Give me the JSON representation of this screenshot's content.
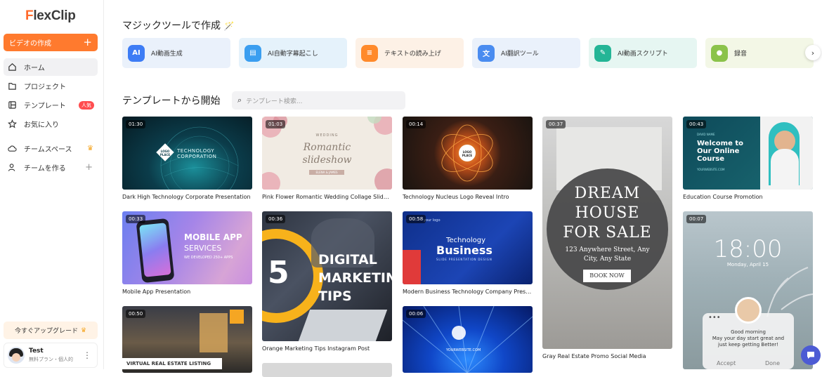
{
  "app": {
    "logo_prefix": "F",
    "logo_rest": "lexClip"
  },
  "sidebar": {
    "create_label": "ビデオの作成",
    "create_plus": "+",
    "items": [
      {
        "label": "ホーム",
        "icon": "home-icon"
      },
      {
        "label": "プロジェクト",
        "icon": "folder-icon"
      },
      {
        "label": "テンプレート",
        "icon": "template-icon",
        "badge": "人気"
      },
      {
        "label": "お気に入り",
        "icon": "star-icon"
      },
      {
        "label": "チームスペース",
        "icon": "cloud-icon"
      },
      {
        "label": "チームを作る",
        "icon": "user-add-icon"
      }
    ],
    "upgrade_label": "今すぐアップグレード",
    "user": {
      "name": "Test",
      "plan": "無料プラン・個人的"
    }
  },
  "magic": {
    "title": "マジックツールで作成",
    "tools": [
      {
        "label": "AI動画生成",
        "bg": "#eaf1fb",
        "icon_bg": "#3d7cf5",
        "glyph": "AI"
      },
      {
        "label": "AI自動字幕起こし",
        "bg": "#e5f2fb",
        "icon_bg": "#3a9ef0",
        "glyph": "▤"
      },
      {
        "label": "テキストの読み上げ",
        "bg": "#fdf1e6",
        "icon_bg": "#ff8a2b",
        "glyph": "≡"
      },
      {
        "label": "AI翻訳ツール",
        "bg": "#eaf1fb",
        "icon_bg": "#4a8cf0",
        "glyph": "文"
      },
      {
        "label": "AI動画スクリプト",
        "bg": "#e6f6f2",
        "icon_bg": "#24b596",
        "glyph": "✎"
      },
      {
        "label": "録音",
        "bg": "#f3f7e6",
        "icon_bg": "#8bc34a",
        "glyph": "●"
      }
    ]
  },
  "templates": {
    "title": "テンプレートから開始",
    "search_placeholder": "テンプレート検索...",
    "cards": [
      {
        "dur": "01:30",
        "caption": "Dark High Technology Corporate Presentation",
        "logo": "LOGO PLACE",
        "text": "TECHNOLOGY CORPORATION"
      },
      {
        "dur": "01:03",
        "caption": "Pink Flower Romantic Wedding Collage Slides...",
        "kicker": "WEDDING",
        "line1": "Romantic",
        "line2": "slideshow",
        "sub": "ELENA & JAMES"
      },
      {
        "dur": "00:14",
        "caption": "Technology Nucleus Logo Reveal Intro",
        "logo": "LOGO PLACE"
      },
      {
        "dur": "00:37",
        "caption": "Gray Real Estate Promo Social Media",
        "l1": "DREAM",
        "l2": "HOUSE",
        "l3": "FOR SALE",
        "addr": "123 Anywhere Street, Any City, Any State",
        "cta": "BOOK NOW"
      },
      {
        "dur": "00:43",
        "caption": "Education Course Promotion",
        "top": "DAVID NAME",
        "line": "Welcome to Our Online Course",
        "site": "YOURWEBSITE.COM"
      },
      {
        "dur": "00:33",
        "caption": "Mobile App Presentation",
        "t1": "MOBILE APP",
        "t2": "SERVICES",
        "t3": "WE DEVELOPED 250+ APPS"
      },
      {
        "dur": "00:36",
        "caption": "Orange Marketing Tips Instagram Post",
        "num": "5",
        "l1": "DIGITAL",
        "l2": "MARKETING",
        "l3": "TIPS"
      },
      {
        "dur": "00:58",
        "caption": "Modern Business Technology Company Prese...",
        "t1": "Technology",
        "t2": "Business",
        "t3": "SLIDE PRESENTATION DESIGN",
        "logo": "your logo"
      },
      {
        "dur": "00:07",
        "caption": "",
        "time": "18:00",
        "date": "Monday, April 15",
        "msg1": "Good morning",
        "msg2": "May your day start great and",
        "msg3": "just keep getting Better!",
        "accept": "Accept",
        "done": "Done"
      },
      {
        "dur": "00:50",
        "caption": "",
        "title": "VIRTUAL REAL ESTATE LISTING"
      },
      {
        "dur": "00:06",
        "caption": "",
        "site": "YOURWEBSITE.COM"
      }
    ]
  }
}
